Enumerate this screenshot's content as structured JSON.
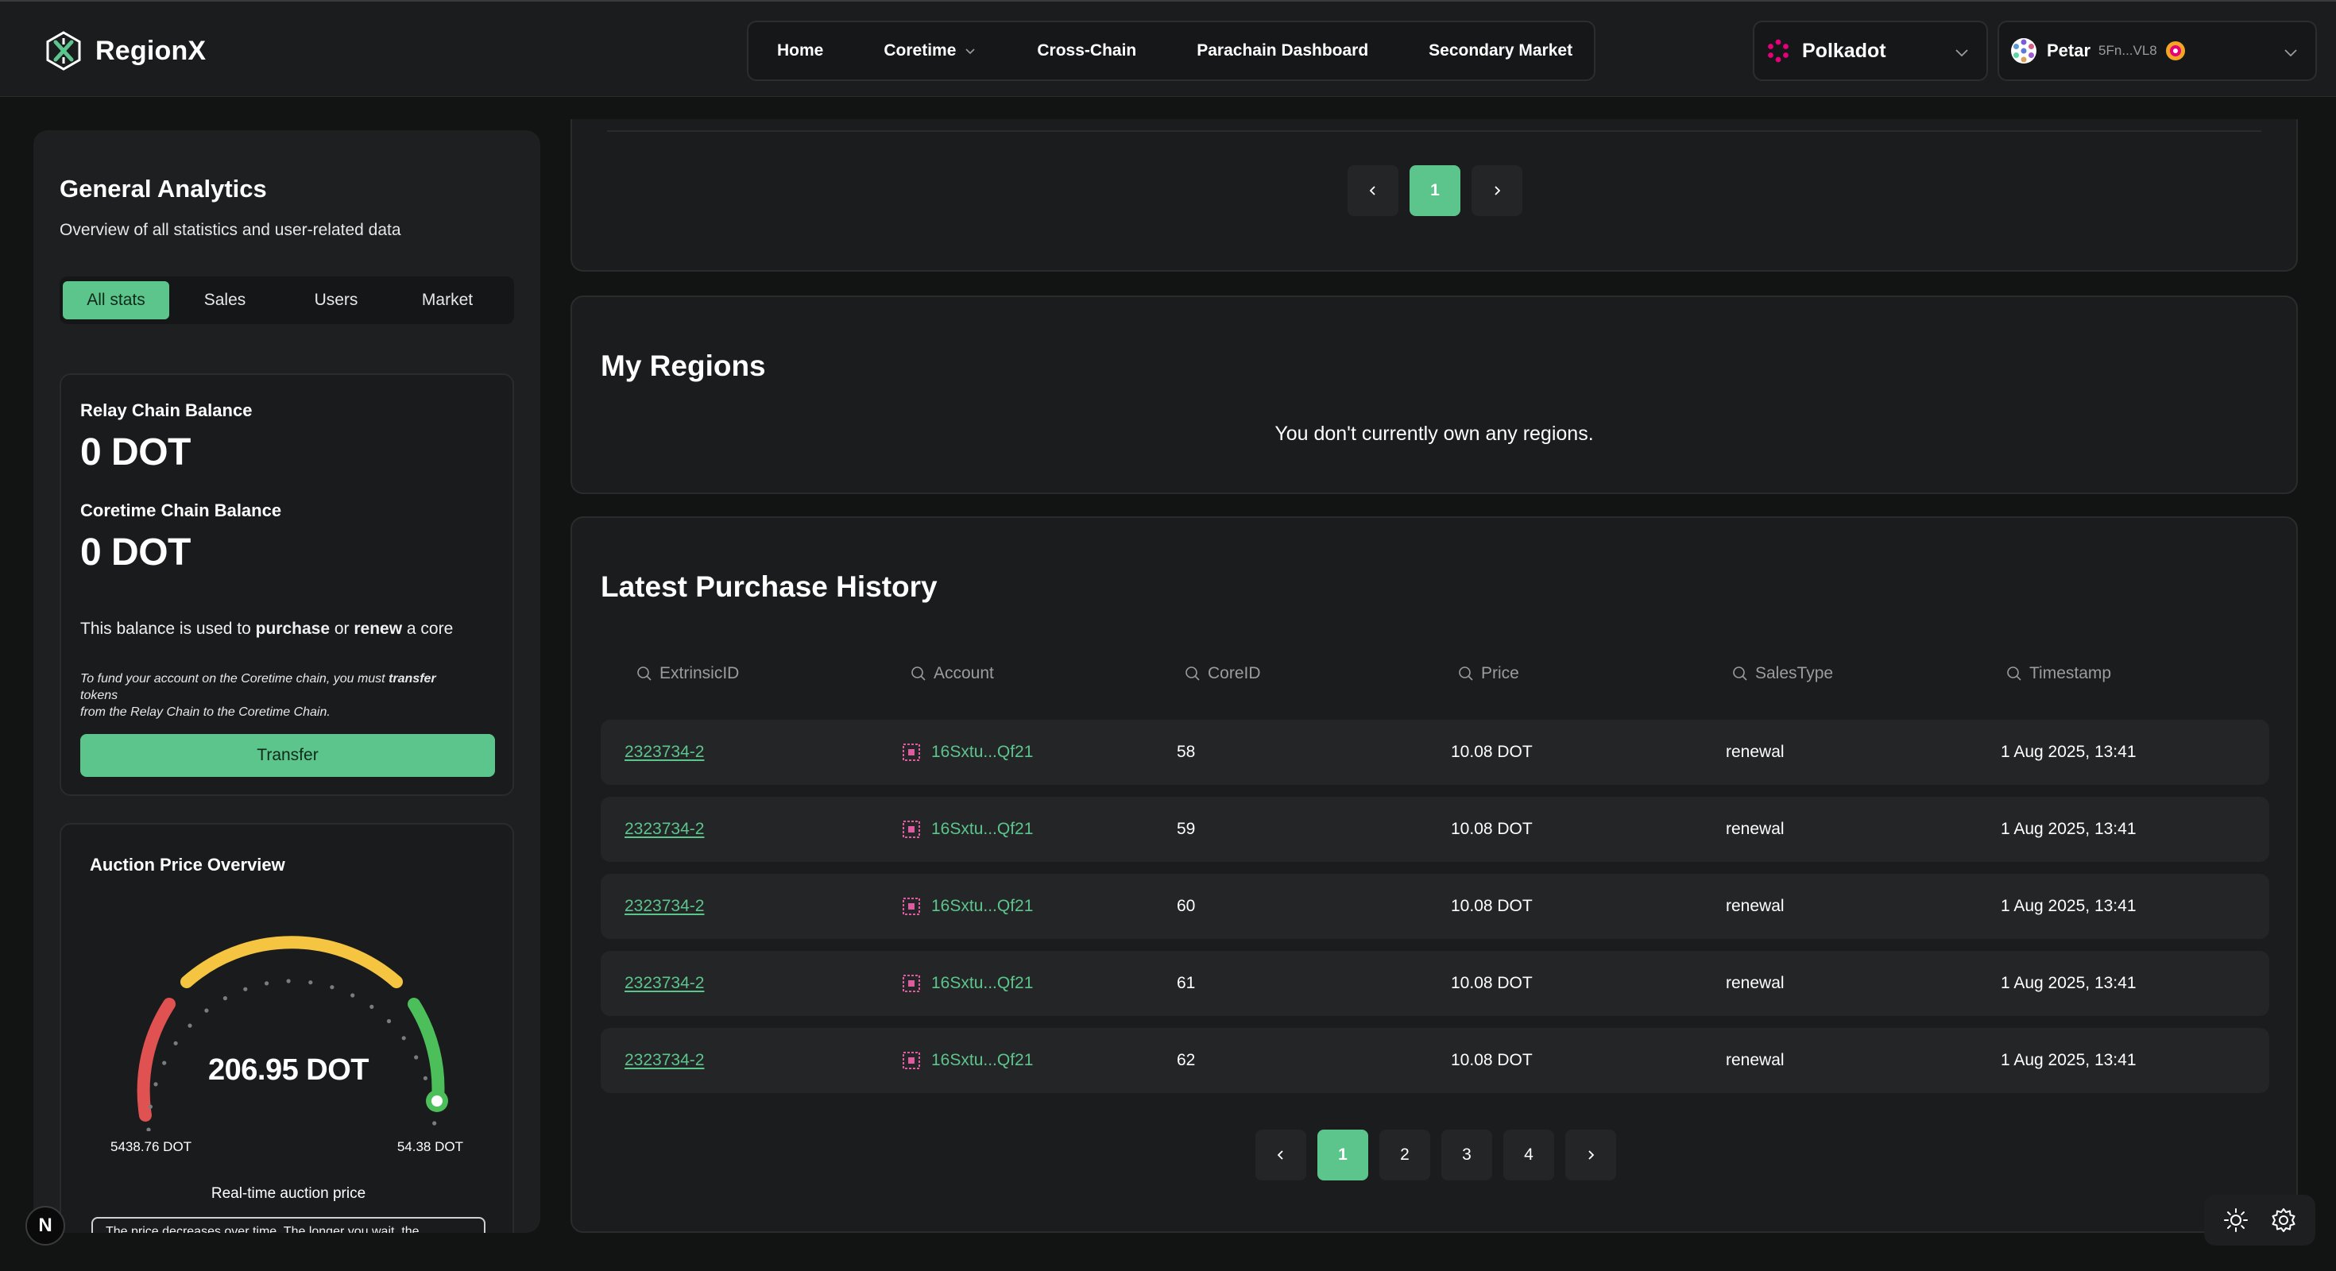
{
  "app": {
    "name": "RegionX"
  },
  "nav": {
    "items": [
      {
        "label": "Home",
        "has_dropdown": false
      },
      {
        "label": "Coretime",
        "has_dropdown": true
      },
      {
        "label": "Cross-Chain",
        "has_dropdown": false
      },
      {
        "label": "Parachain Dashboard",
        "has_dropdown": false
      },
      {
        "label": "Secondary Market",
        "has_dropdown": false
      }
    ]
  },
  "network": {
    "label": "Polkadot",
    "icon": "polkadot-icon",
    "color": "#e6007a"
  },
  "account": {
    "name": "Petar",
    "address": "5Fn...VL8"
  },
  "sidebar": {
    "title": "General Analytics",
    "subtitle": "Overview of all statistics and user-related data",
    "tabs": [
      "All stats",
      "Sales",
      "Users",
      "Market"
    ],
    "active_tab": "All stats",
    "relay_label": "Relay Chain Balance",
    "relay_value": "0 DOT",
    "coretime_label": "Coretime Chain Balance",
    "coretime_value": "0 DOT",
    "note_prefix": "This balance is used to ",
    "note_purchase": "purchase",
    "note_mid": " or ",
    "note_renew": "renew",
    "note_suffix": " a core",
    "fund_prefix": "To fund your account on the Coretime chain, you must ",
    "fund_bold": "transfer",
    "fund_line2": "tokens",
    "fund_line3": "from the Relay Chain to the Coretime Chain.",
    "transfer_label": "Transfer",
    "auction": {
      "title": "Auction Price Overview",
      "current": "206.95 DOT",
      "min_label": "5438.76 DOT",
      "max_label": "54.38 DOT",
      "caption": "Real-time auction price",
      "description": "The price decreases over time. The longer you wait, the"
    }
  },
  "top_pager": {
    "pages": [
      "1"
    ],
    "active": "1"
  },
  "regions": {
    "title": "My Regions",
    "empty": "You don't currently own any regions."
  },
  "history": {
    "title": "Latest Purchase History",
    "columns": [
      "ExtrinsicID",
      "Account",
      "CoreID",
      "Price",
      "SalesType",
      "Timestamp"
    ],
    "rows": [
      {
        "extrinsic": "2323734-2",
        "account": "16Sxtu...Qf21",
        "core": "58",
        "price": "10.08 DOT",
        "type": "renewal",
        "time": "1 Aug 2025, 13:41"
      },
      {
        "extrinsic": "2323734-2",
        "account": "16Sxtu...Qf21",
        "core": "59",
        "price": "10.08 DOT",
        "type": "renewal",
        "time": "1 Aug 2025, 13:41"
      },
      {
        "extrinsic": "2323734-2",
        "account": "16Sxtu...Qf21",
        "core": "60",
        "price": "10.08 DOT",
        "type": "renewal",
        "time": "1 Aug 2025, 13:41"
      },
      {
        "extrinsic": "2323734-2",
        "account": "16Sxtu...Qf21",
        "core": "61",
        "price": "10.08 DOT",
        "type": "renewal",
        "time": "1 Aug 2025, 13:41"
      },
      {
        "extrinsic": "2323734-2",
        "account": "16Sxtu...Qf21",
        "core": "62",
        "price": "10.08 DOT",
        "type": "renewal",
        "time": "1 Aug 2025, 13:41"
      }
    ],
    "pager": {
      "pages": [
        "1",
        "2",
        "3",
        "4"
      ],
      "active": "1"
    }
  },
  "floating": {
    "dev_badge": "N",
    "icons": [
      "sun-icon",
      "gear-icon"
    ]
  },
  "colors": {
    "accent": "#5cc58c",
    "background": "#121313",
    "panel": "#1b1c1d"
  }
}
